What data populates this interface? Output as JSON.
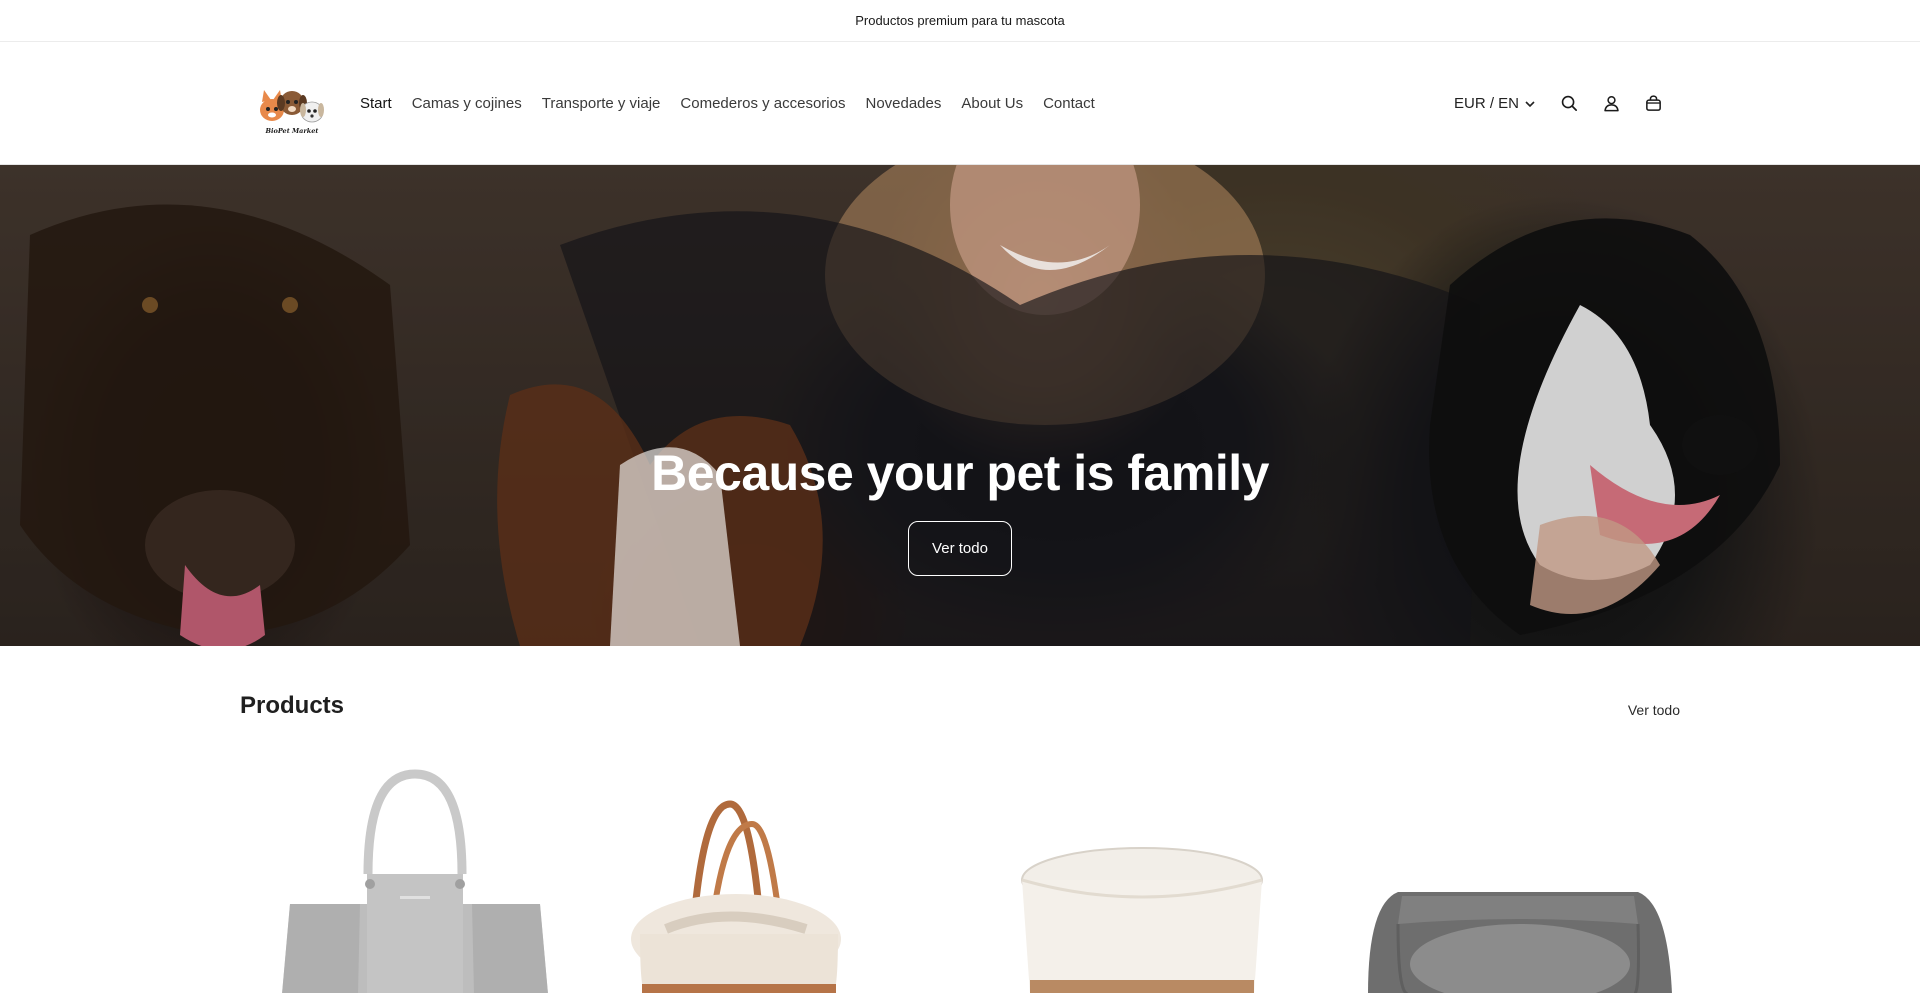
{
  "announcement": {
    "text": "Productos premium para tu mascota"
  },
  "header": {
    "logo_text": "BioPet Market",
    "nav": [
      {
        "label": "Start",
        "active": true
      },
      {
        "label": "Camas y cojines"
      },
      {
        "label": "Transporte y viaje"
      },
      {
        "label": "Comederos y accesorios"
      },
      {
        "label": "Novedades"
      },
      {
        "label": "About Us"
      },
      {
        "label": "Contact"
      }
    ],
    "currency": "EUR / EN",
    "icons": [
      "search-icon",
      "account-icon",
      "cart-icon"
    ]
  },
  "hero": {
    "title": "Because your pet is family",
    "button_label": "Ver todo"
  },
  "products": {
    "title": "Products",
    "view_all_label": "Ver todo",
    "items": [
      {
        "image": "grey-woven-tote-bag"
      },
      {
        "image": "fleece-carrier-bag-with-brown-handles"
      },
      {
        "image": "white-and-wood-ceramic-bowl"
      },
      {
        "image": "grey-rectangular-dog-bed"
      }
    ]
  },
  "colors": {
    "text": "#121212",
    "hero_overlay": "#000000",
    "hero_text": "#ffffff"
  }
}
